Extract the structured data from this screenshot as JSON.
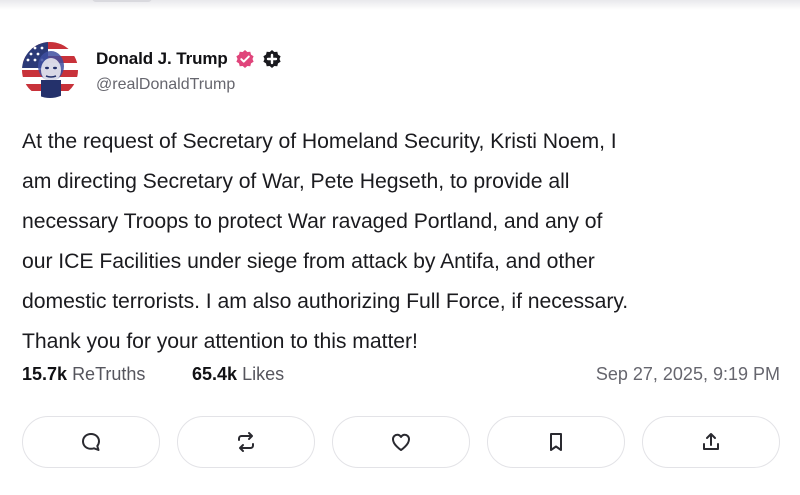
{
  "post": {
    "author_name": "Donald J. Trump",
    "handle": "@realDonaldTrump",
    "lines": [
      "At the request of Secretary of Homeland Security, Kristi Noem, I",
      "am directing Secretary of War, Pete Hegseth, to provide all",
      "necessary Troops to protect War ravaged Portland, and any of",
      "our ICE Facilities under siege from attack by Antifa, and other",
      "domestic terrorists. I am also authorizing Full Force, if necessary.",
      "Thank you for your attention to this matter!"
    ],
    "retruths_count": "15.7k",
    "retruths_label": "ReTruths",
    "likes_count": "65.4k",
    "likes_label": "Likes",
    "timestamp": "Sep 27, 2025, 9:19 PM"
  },
  "icons": {
    "verified": "verified-badge-icon",
    "plus": "plus-badge-icon",
    "reply": "reply-icon",
    "retruth": "retruth-icon",
    "like": "heart-icon",
    "bookmark": "bookmark-icon",
    "share": "share-icon"
  },
  "colors": {
    "verified_badge": "#e0457b",
    "text": "#1b1b1f",
    "muted": "#66666e",
    "button_border": "#e3e3e7"
  }
}
